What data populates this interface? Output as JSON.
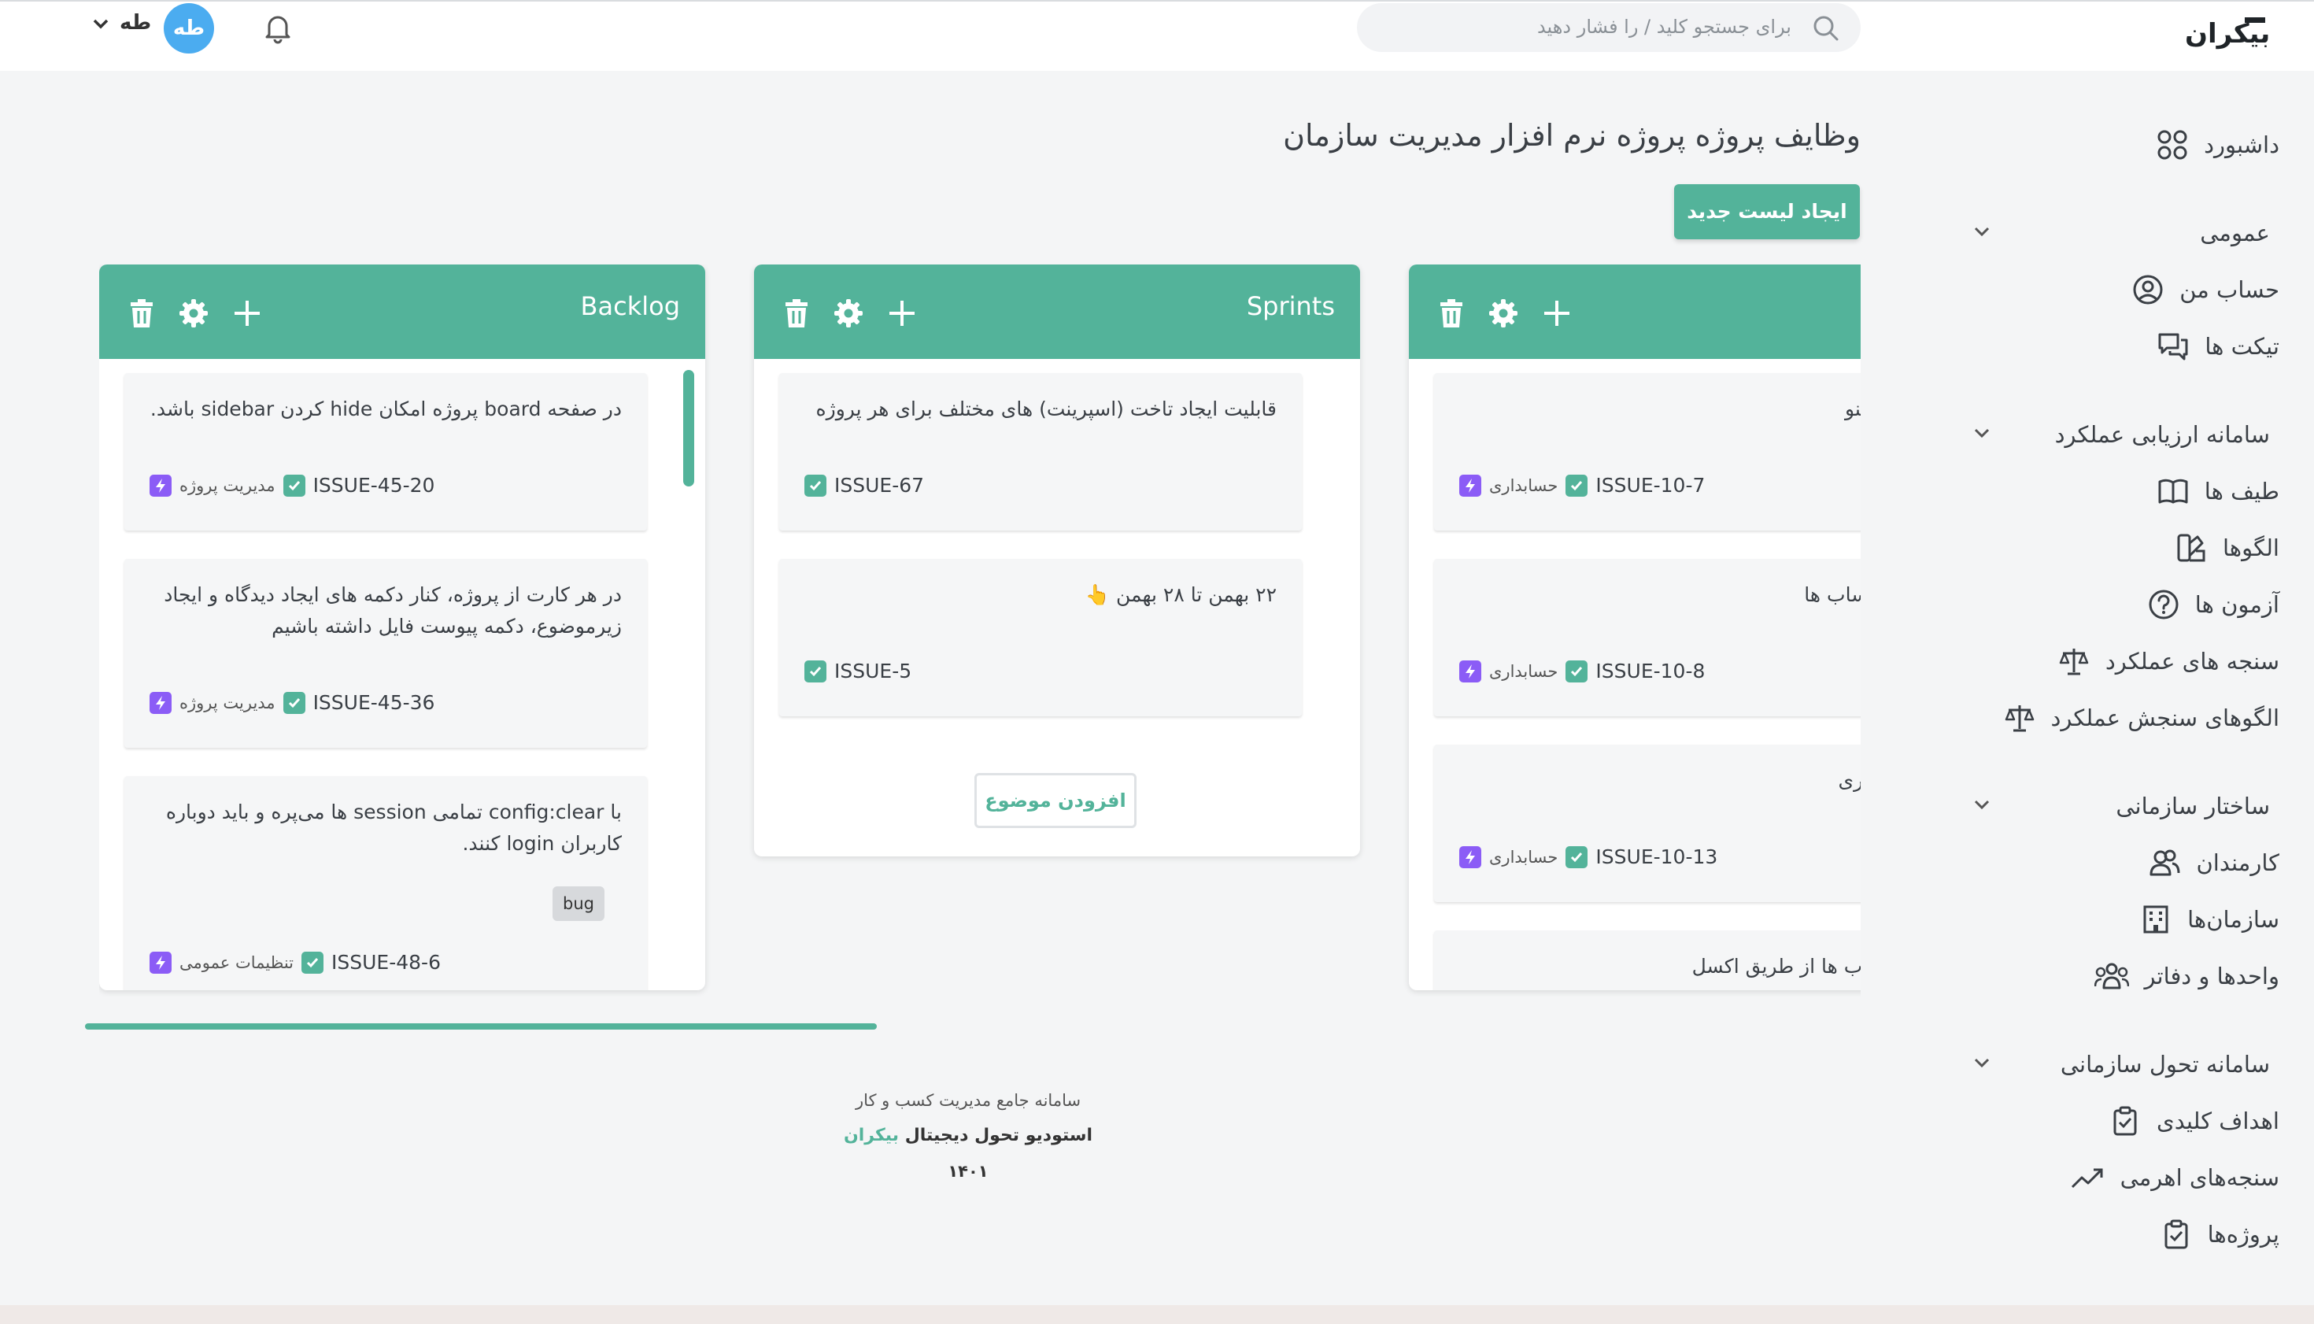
{
  "header": {
    "logo_text": "بیکران",
    "search_placeholder": "برای جستجو کلید / را فشار دهید",
    "avatar_initials": "طه",
    "user_name": "طه"
  },
  "sidebar": {
    "dashboard": "داشبورد",
    "general": {
      "title": "عمومی",
      "items": [
        "حساب من",
        "تیکت ها"
      ]
    },
    "performance": {
      "title": "سامانه ارزیابی عملکرد",
      "items": [
        "طیف ها",
        "الگوها",
        "آزمون ها",
        "سنجه های عملکرد",
        "الگوهای سنجش عملکرد"
      ]
    },
    "org_structure": {
      "title": "ساختار سازمانی",
      "items": [
        "کارمندان",
        "سازمان‌ها",
        "واحدها و دفاتر"
      ]
    },
    "org_transform": {
      "title": "سامانه تحول سازمانی",
      "items": [
        "اهداف کلیدی",
        "سنجه‌های اهرمی",
        "پروژه‌ها"
      ]
    }
  },
  "main": {
    "title": "وظایف پروژه پروژه نرم افزار مدیریت سازمان",
    "create_list_label": "ایجاد لیست جدید"
  },
  "lists": {
    "backlog": {
      "title": "Backlog",
      "cards": [
        {
          "text": "در صفحه board پروژه امکان hide کردن sidebar باشد.",
          "issue": "ISSUE-45-20",
          "tag": "مدیریت پروژه"
        },
        {
          "text": "در هر کارت از پروژه، کنار دکمه های ایجاد دیدگاه و ایجاد زیرموضوع، دکمه پیوست فایل داشته باشیم",
          "issue": "ISSUE-45-36",
          "tag": "مدیریت پروژه"
        },
        {
          "text": "با config:clear تمامی session ها می‌پره و باید دوباره کاربران login کنند.",
          "label": "bug",
          "issue": "ISSUE-48-6",
          "tag": "تنظیمات عمومی"
        }
      ]
    },
    "sprints": {
      "title": "Sprints",
      "cards": [
        {
          "text": "قابلیت ایجاد تاخت (اسپرینت) های مختلف برای هر پروژه",
          "issue": "ISSUE-67"
        },
        {
          "text": "۲۲ بهمن تا ۲۸ بهمن 👆",
          "issue": "ISSUE-5"
        }
      ],
      "add_topic_label": "افزودن موضوع"
    },
    "third": {
      "title": "",
      "cards": [
        {
          "text": "ه حسابداری در منو",
          "issue": "ISSUE-10-7",
          "tag": "حسابداری"
        },
        {
          "text": "ریف درختواره حساب ها",
          "issue": "ISSUE-10-8",
          "tag": "حسابداری"
        },
        {
          "text": "ریف سند حسابداری",
          "issue": "ISSUE-10-13",
          "tag": "حسابداری"
        },
        {
          "text": "ود درختواره حساب ها از طریق اکسل"
        }
      ]
    }
  },
  "footer": {
    "line1": "سامانه جامع مدیریت کسب و کار",
    "line2_prefix": "استودیو تحول دیجیتال",
    "line2_brand": "بیکران",
    "year": "۱۴۰۱"
  },
  "colors": {
    "accent": "#53b39a",
    "avatar": "#4bacf0",
    "tag": "#8b5cf6"
  }
}
